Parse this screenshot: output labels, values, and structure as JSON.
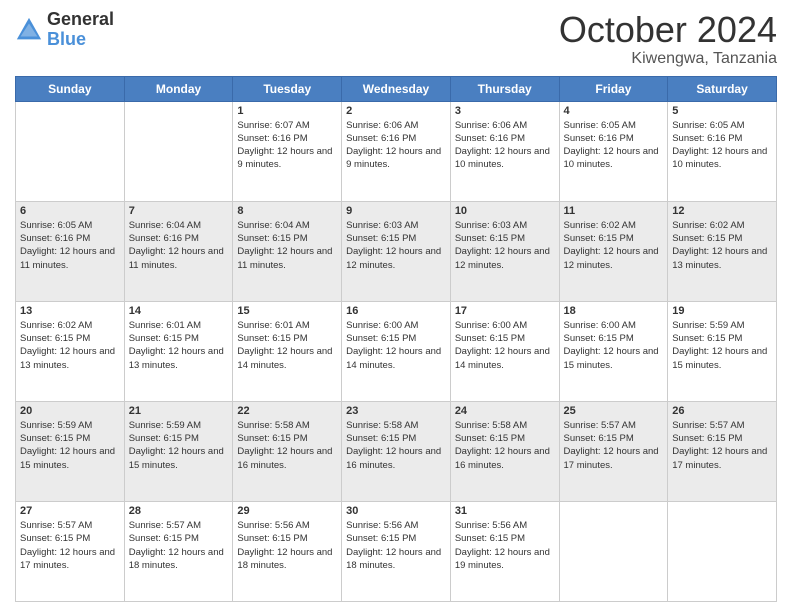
{
  "header": {
    "logo_general": "General",
    "logo_blue": "Blue",
    "month_title": "October 2024",
    "location": "Kiwengwa, Tanzania"
  },
  "days_of_week": [
    "Sunday",
    "Monday",
    "Tuesday",
    "Wednesday",
    "Thursday",
    "Friday",
    "Saturday"
  ],
  "weeks": [
    [
      {
        "day": "",
        "info": ""
      },
      {
        "day": "",
        "info": ""
      },
      {
        "day": "1",
        "info": "Sunrise: 6:07 AM\nSunset: 6:16 PM\nDaylight: 12 hours and 9 minutes."
      },
      {
        "day": "2",
        "info": "Sunrise: 6:06 AM\nSunset: 6:16 PM\nDaylight: 12 hours and 9 minutes."
      },
      {
        "day": "3",
        "info": "Sunrise: 6:06 AM\nSunset: 6:16 PM\nDaylight: 12 hours and 10 minutes."
      },
      {
        "day": "4",
        "info": "Sunrise: 6:05 AM\nSunset: 6:16 PM\nDaylight: 12 hours and 10 minutes."
      },
      {
        "day": "5",
        "info": "Sunrise: 6:05 AM\nSunset: 6:16 PM\nDaylight: 12 hours and 10 minutes."
      }
    ],
    [
      {
        "day": "6",
        "info": "Sunrise: 6:05 AM\nSunset: 6:16 PM\nDaylight: 12 hours and 11 minutes."
      },
      {
        "day": "7",
        "info": "Sunrise: 6:04 AM\nSunset: 6:16 PM\nDaylight: 12 hours and 11 minutes."
      },
      {
        "day": "8",
        "info": "Sunrise: 6:04 AM\nSunset: 6:15 PM\nDaylight: 12 hours and 11 minutes."
      },
      {
        "day": "9",
        "info": "Sunrise: 6:03 AM\nSunset: 6:15 PM\nDaylight: 12 hours and 12 minutes."
      },
      {
        "day": "10",
        "info": "Sunrise: 6:03 AM\nSunset: 6:15 PM\nDaylight: 12 hours and 12 minutes."
      },
      {
        "day": "11",
        "info": "Sunrise: 6:02 AM\nSunset: 6:15 PM\nDaylight: 12 hours and 12 minutes."
      },
      {
        "day": "12",
        "info": "Sunrise: 6:02 AM\nSunset: 6:15 PM\nDaylight: 12 hours and 13 minutes."
      }
    ],
    [
      {
        "day": "13",
        "info": "Sunrise: 6:02 AM\nSunset: 6:15 PM\nDaylight: 12 hours and 13 minutes."
      },
      {
        "day": "14",
        "info": "Sunrise: 6:01 AM\nSunset: 6:15 PM\nDaylight: 12 hours and 13 minutes."
      },
      {
        "day": "15",
        "info": "Sunrise: 6:01 AM\nSunset: 6:15 PM\nDaylight: 12 hours and 14 minutes."
      },
      {
        "day": "16",
        "info": "Sunrise: 6:00 AM\nSunset: 6:15 PM\nDaylight: 12 hours and 14 minutes."
      },
      {
        "day": "17",
        "info": "Sunrise: 6:00 AM\nSunset: 6:15 PM\nDaylight: 12 hours and 14 minutes."
      },
      {
        "day": "18",
        "info": "Sunrise: 6:00 AM\nSunset: 6:15 PM\nDaylight: 12 hours and 15 minutes."
      },
      {
        "day": "19",
        "info": "Sunrise: 5:59 AM\nSunset: 6:15 PM\nDaylight: 12 hours and 15 minutes."
      }
    ],
    [
      {
        "day": "20",
        "info": "Sunrise: 5:59 AM\nSunset: 6:15 PM\nDaylight: 12 hours and 15 minutes."
      },
      {
        "day": "21",
        "info": "Sunrise: 5:59 AM\nSunset: 6:15 PM\nDaylight: 12 hours and 15 minutes."
      },
      {
        "day": "22",
        "info": "Sunrise: 5:58 AM\nSunset: 6:15 PM\nDaylight: 12 hours and 16 minutes."
      },
      {
        "day": "23",
        "info": "Sunrise: 5:58 AM\nSunset: 6:15 PM\nDaylight: 12 hours and 16 minutes."
      },
      {
        "day": "24",
        "info": "Sunrise: 5:58 AM\nSunset: 6:15 PM\nDaylight: 12 hours and 16 minutes."
      },
      {
        "day": "25",
        "info": "Sunrise: 5:57 AM\nSunset: 6:15 PM\nDaylight: 12 hours and 17 minutes."
      },
      {
        "day": "26",
        "info": "Sunrise: 5:57 AM\nSunset: 6:15 PM\nDaylight: 12 hours and 17 minutes."
      }
    ],
    [
      {
        "day": "27",
        "info": "Sunrise: 5:57 AM\nSunset: 6:15 PM\nDaylight: 12 hours and 17 minutes."
      },
      {
        "day": "28",
        "info": "Sunrise: 5:57 AM\nSunset: 6:15 PM\nDaylight: 12 hours and 18 minutes."
      },
      {
        "day": "29",
        "info": "Sunrise: 5:56 AM\nSunset: 6:15 PM\nDaylight: 12 hours and 18 minutes."
      },
      {
        "day": "30",
        "info": "Sunrise: 5:56 AM\nSunset: 6:15 PM\nDaylight: 12 hours and 18 minutes."
      },
      {
        "day": "31",
        "info": "Sunrise: 5:56 AM\nSunset: 6:15 PM\nDaylight: 12 hours and 19 minutes."
      },
      {
        "day": "",
        "info": ""
      },
      {
        "day": "",
        "info": ""
      }
    ]
  ]
}
